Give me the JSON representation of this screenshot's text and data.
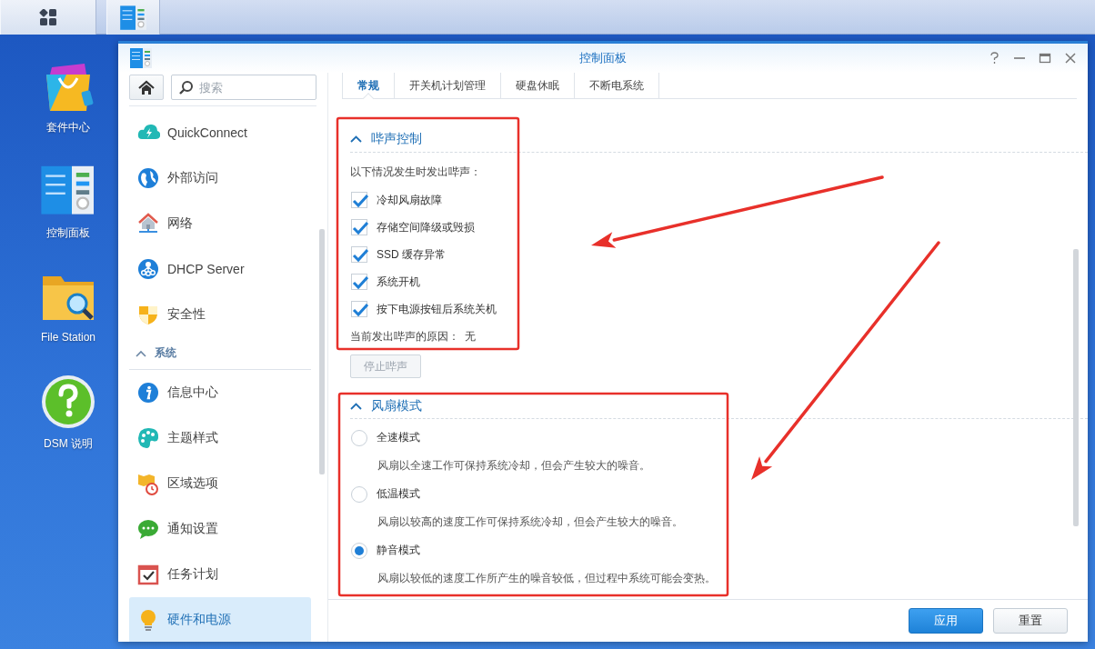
{
  "desktop_icons": [
    {
      "kind": "package",
      "label": "套件中心"
    },
    {
      "kind": "control-panel",
      "label": "控制面板"
    },
    {
      "kind": "folder",
      "label": "File Station"
    },
    {
      "kind": "help",
      "label": "DSM 说明"
    }
  ],
  "window": {
    "title": "控制面板"
  },
  "sidebar": {
    "search": {
      "placeholder": "搜索"
    },
    "items": [
      {
        "kind": "item",
        "label": "QuickConnect",
        "selected": false
      },
      {
        "kind": "item",
        "label": "外部访问",
        "selected": false
      },
      {
        "kind": "item",
        "label": "网络",
        "selected": false
      },
      {
        "kind": "item",
        "label": "DHCP Server",
        "selected": false
      },
      {
        "kind": "item",
        "label": "安全性",
        "selected": false
      },
      {
        "kind": "header",
        "label": "系统",
        "expanded": true
      },
      {
        "kind": "item",
        "label": "信息中心",
        "selected": false
      },
      {
        "kind": "item",
        "label": "主题样式",
        "selected": false
      },
      {
        "kind": "item",
        "label": "区域选项",
        "selected": false
      },
      {
        "kind": "item",
        "label": "通知设置",
        "selected": false
      },
      {
        "kind": "item",
        "label": "任务计划",
        "selected": false
      },
      {
        "kind": "item",
        "label": "硬件和电源",
        "selected": true
      }
    ]
  },
  "tabs": [
    {
      "label": "常规",
      "selected": true
    },
    {
      "label": "开关机计划管理",
      "selected": false
    },
    {
      "label": "硬盘休眠",
      "selected": false
    },
    {
      "label": "不断电系统",
      "selected": false
    }
  ],
  "beep": {
    "title": "哔声控制",
    "expanded": true,
    "intro": "以下情况发生时发出哔声：",
    "options": [
      {
        "label": "冷却风扇故障",
        "checked": true
      },
      {
        "label": "存储空间降级或毁损",
        "checked": true
      },
      {
        "label": "SSD 缓存异常",
        "checked": true
      },
      {
        "label": "系统开机",
        "checked": true
      },
      {
        "label": "按下电源按钮后系统关机",
        "checked": true
      }
    ],
    "status_label": "当前发出哔声的原因：",
    "status_value": "无",
    "stop_button": {
      "label": "停止哔声",
      "disabled": true
    }
  },
  "fan": {
    "title": "风扇模式",
    "expanded": true,
    "modes": [
      {
        "label": "全速模式",
        "description": "风扇以全速工作可保持系统冷却，但会产生较大的噪音。",
        "selected": false
      },
      {
        "label": "低温模式",
        "description": "风扇以较高的速度工作可保持系统冷却，但会产生较大的噪音。",
        "selected": false
      },
      {
        "label": "静音模式",
        "description": "风扇以较低的速度工作所产生的噪音较低，但过程中系统可能会变热。",
        "selected": true
      }
    ]
  },
  "footer_buttons": [
    {
      "kind": "primary",
      "label": "应用"
    },
    {
      "kind": "default",
      "label": "重置"
    }
  ],
  "annotations": [
    {
      "kind": "box"
    },
    {
      "kind": "box"
    },
    {
      "kind": "arrow"
    },
    {
      "kind": "arrow"
    }
  ]
}
